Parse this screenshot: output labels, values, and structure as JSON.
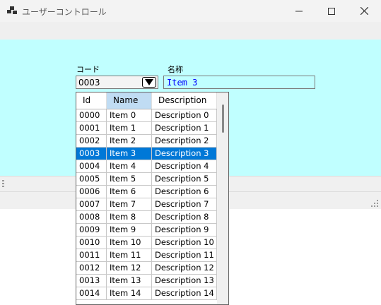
{
  "window": {
    "title": "ユーザーコントロール",
    "icons": {
      "app": "app-icon",
      "minimize": "minimize-icon",
      "maximize": "maximize-icon",
      "close": "close-icon"
    }
  },
  "colors": {
    "client_bg": "#c0ffff",
    "selection": "#0078d7",
    "name_text": "#0000ff"
  },
  "form": {
    "code_label": "コード",
    "code_value": "0003",
    "dropdown_icon": "triangle-down-icon",
    "name_label": "名称",
    "name_value": "Item 3"
  },
  "grid": {
    "columns": [
      "Id",
      "Name",
      "Description"
    ],
    "sorted_column": "Name",
    "selected_id": "0003",
    "rows": [
      {
        "id": "0000",
        "name": "Item 0",
        "desc": "Description 0"
      },
      {
        "id": "0001",
        "name": "Item 1",
        "desc": "Description 1"
      },
      {
        "id": "0002",
        "name": "Item 2",
        "desc": "Description 2"
      },
      {
        "id": "0003",
        "name": "Item 3",
        "desc": "Description 3"
      },
      {
        "id": "0004",
        "name": "Item 4",
        "desc": "Description 4"
      },
      {
        "id": "0005",
        "name": "Item 5",
        "desc": "Description 5"
      },
      {
        "id": "0006",
        "name": "Item 6",
        "desc": "Description 6"
      },
      {
        "id": "0007",
        "name": "Item 7",
        "desc": "Description 7"
      },
      {
        "id": "0008",
        "name": "Item 8",
        "desc": "Description 8"
      },
      {
        "id": "0009",
        "name": "Item 9",
        "desc": "Description 9"
      },
      {
        "id": "0010",
        "name": "Item 10",
        "desc": "Description 10"
      },
      {
        "id": "0011",
        "name": "Item 11",
        "desc": "Description 11"
      },
      {
        "id": "0012",
        "name": "Item 12",
        "desc": "Description 12"
      },
      {
        "id": "0013",
        "name": "Item 13",
        "desc": "Description 13"
      },
      {
        "id": "0014",
        "name": "Item 14",
        "desc": "Description 14"
      }
    ]
  }
}
